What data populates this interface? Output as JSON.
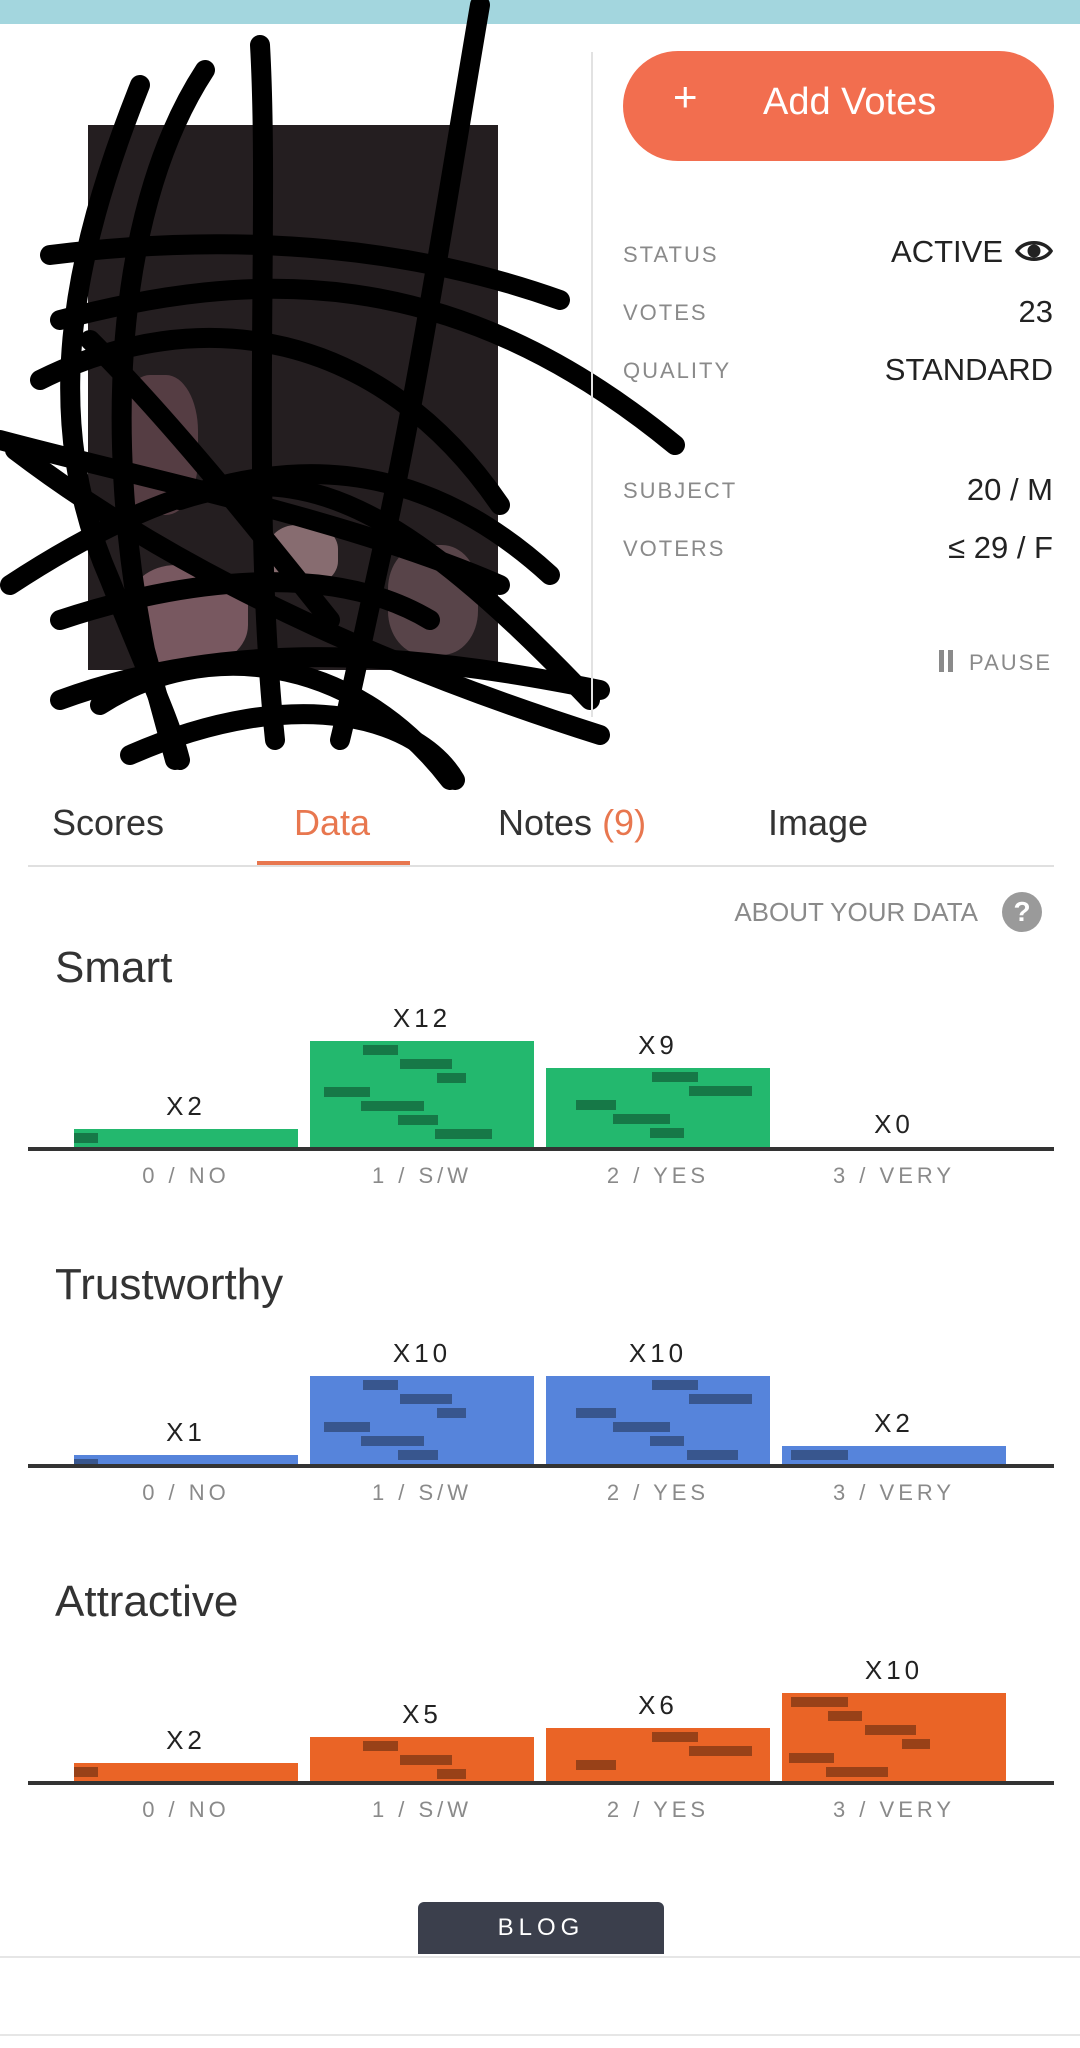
{
  "colors": {
    "accent": "#f26e4f",
    "tab_active": "#e8774f",
    "topbar": "#a3d6de",
    "smart": "#23b86e",
    "trustworthy": "#5684db",
    "attractive": "#ea6426"
  },
  "actions": {
    "add_votes_plus": "+",
    "add_votes": "Add Votes",
    "pause": "PAUSE"
  },
  "info": [
    {
      "label": "STATUS",
      "value": "ACTIVE"
    },
    {
      "label": "VOTES",
      "value": "23"
    },
    {
      "label": "QUALITY",
      "value": "STANDARD"
    },
    {
      "label": "SUBJECT",
      "value": "20 / M"
    },
    {
      "label": "VOTERS",
      "value": "≤ 29 / F"
    }
  ],
  "tabs": [
    {
      "label": "Scores"
    },
    {
      "label": "Data",
      "active": true
    },
    {
      "label": "Notes",
      "count": "(9)"
    },
    {
      "label": "Image"
    }
  ],
  "about": {
    "label": "ABOUT YOUR DATA",
    "help_icon": "?"
  },
  "charts": [
    {
      "title": "Smart",
      "color": "#23b86e",
      "categories": [
        "0 / NO",
        "1 / S/W",
        "2 / YES",
        "3 / VERY"
      ],
      "values": [
        2,
        12,
        9,
        0
      ],
      "labels": [
        "X2",
        "X12",
        "X9",
        "X0"
      ]
    },
    {
      "title": "Trustworthy",
      "color": "#5684db",
      "categories": [
        "0 / NO",
        "1 / S/W",
        "2 / YES",
        "3 / VERY"
      ],
      "values": [
        1,
        10,
        10,
        2
      ],
      "labels": [
        "X1",
        "X10",
        "X10",
        "X2"
      ]
    },
    {
      "title": "Attractive",
      "color": "#ea6426",
      "categories": [
        "0 / NO",
        "1 / S/W",
        "2 / YES",
        "3 / VERY"
      ],
      "values": [
        2,
        5,
        6,
        10
      ],
      "labels": [
        "X2",
        "X5",
        "X6",
        "X10"
      ]
    }
  ],
  "footer": {
    "blog": "BLOG"
  }
}
